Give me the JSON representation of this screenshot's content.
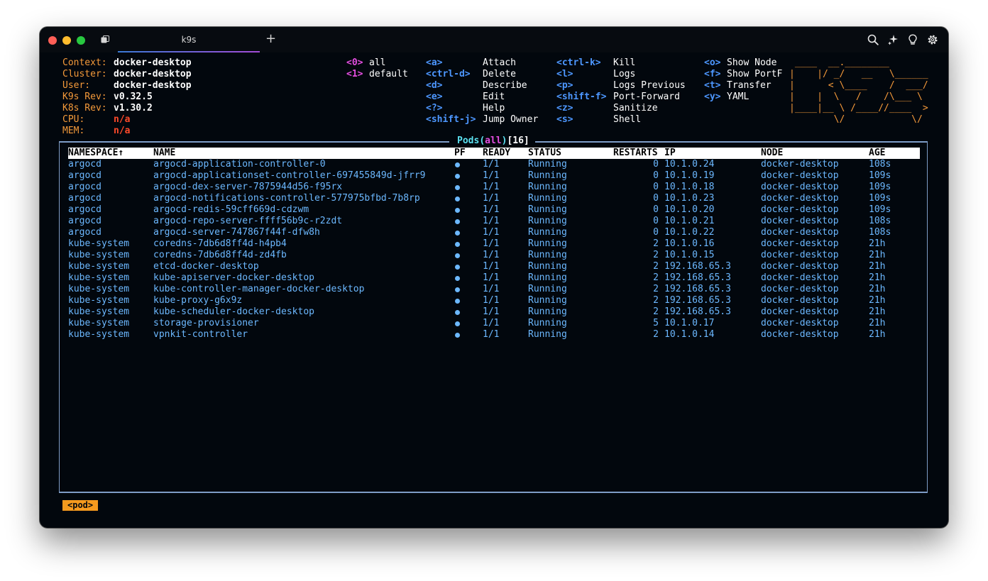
{
  "window": {
    "tab_title": "k9s",
    "new_tab_label": "+",
    "icons": [
      "tabs-overview-icon",
      "search-icon",
      "sparkle-icon",
      "lightbulb-icon",
      "gear-icon"
    ]
  },
  "info": {
    "labels": [
      "Context:",
      "Cluster:",
      "User:",
      "K9s Rev:",
      "K8s Rev:",
      "CPU:",
      "MEM:"
    ],
    "values": [
      "docker-desktop",
      "docker-desktop",
      "docker-desktop",
      "v0.32.5",
      "v1.30.2",
      "n/a",
      "n/a"
    ]
  },
  "namespaces": [
    {
      "key": "<0>",
      "label": "all"
    },
    {
      "key": "<1>",
      "label": "default"
    }
  ],
  "shortcuts": {
    "col1": [
      {
        "key": "<a>",
        "label": "Attach"
      },
      {
        "key": "<ctrl-d>",
        "label": "Delete"
      },
      {
        "key": "<d>",
        "label": "Describe"
      },
      {
        "key": "<e>",
        "label": "Edit"
      },
      {
        "key": "<?>",
        "label": "Help"
      },
      {
        "key": "<shift-j>",
        "label": "Jump Owner"
      }
    ],
    "col2": [
      {
        "key": "<ctrl-k>",
        "label": "Kill"
      },
      {
        "key": "<l>",
        "label": "Logs"
      },
      {
        "key": "<p>",
        "label": "Logs Previous"
      },
      {
        "key": "<shift-f>",
        "label": "Port-Forward"
      },
      {
        "key": "<z>",
        "label": "Sanitize"
      },
      {
        "key": "<s>",
        "label": "Shell"
      }
    ],
    "col3": [
      {
        "key": "<o>",
        "label": "Show Node"
      },
      {
        "key": "<f>",
        "label": "Show PortF"
      },
      {
        "key": "<t>",
        "label": "Transfer"
      },
      {
        "key": "<y>",
        "label": "YAML"
      }
    ]
  },
  "logo_lines": [
    " ____  __.________       ",
    "|    |/ _/   __   \\______",
    "|      < \\____    /  ___/",
    "|    |  \\   /    /\\___ \\ ",
    "|____|__ \\ /____//____  >",
    "        \\/            \\/ "
  ],
  "table": {
    "title_resource": "Pods",
    "title_paren_open": "(",
    "title_namespace": "all",
    "title_paren_close": ")",
    "title_count": "[16]",
    "columns": [
      "NAMESPACE↑",
      "NAME",
      "PF",
      "READY",
      "STATUS",
      "RESTARTS",
      "IP",
      "NODE",
      "AGE"
    ],
    "rows": [
      {
        "namespace": "argocd",
        "name": "argocd-application-controller-0",
        "ready": "1/1",
        "status": "Running",
        "restarts": "0",
        "ip": "10.1.0.24",
        "node": "docker-desktop",
        "age": "108s"
      },
      {
        "namespace": "argocd",
        "name": "argocd-applicationset-controller-697455849d-jfrr9",
        "ready": "1/1",
        "status": "Running",
        "restarts": "0",
        "ip": "10.1.0.19",
        "node": "docker-desktop",
        "age": "109s"
      },
      {
        "namespace": "argocd",
        "name": "argocd-dex-server-7875944d56-f95rx",
        "ready": "1/1",
        "status": "Running",
        "restarts": "0",
        "ip": "10.1.0.18",
        "node": "docker-desktop",
        "age": "109s"
      },
      {
        "namespace": "argocd",
        "name": "argocd-notifications-controller-577975bfbd-7b8rp",
        "ready": "1/1",
        "status": "Running",
        "restarts": "0",
        "ip": "10.1.0.23",
        "node": "docker-desktop",
        "age": "109s"
      },
      {
        "namespace": "argocd",
        "name": "argocd-redis-59cff669d-cdzwm",
        "ready": "1/1",
        "status": "Running",
        "restarts": "0",
        "ip": "10.1.0.20",
        "node": "docker-desktop",
        "age": "109s"
      },
      {
        "namespace": "argocd",
        "name": "argocd-repo-server-ffff56b9c-r2zdt",
        "ready": "1/1",
        "status": "Running",
        "restarts": "0",
        "ip": "10.1.0.21",
        "node": "docker-desktop",
        "age": "108s"
      },
      {
        "namespace": "argocd",
        "name": "argocd-server-747867f44f-dfw8h",
        "ready": "1/1",
        "status": "Running",
        "restarts": "0",
        "ip": "10.1.0.22",
        "node": "docker-desktop",
        "age": "108s"
      },
      {
        "namespace": "kube-system",
        "name": "coredns-7db6d8ff4d-h4pb4",
        "ready": "1/1",
        "status": "Running",
        "restarts": "2",
        "ip": "10.1.0.16",
        "node": "docker-desktop",
        "age": "21h"
      },
      {
        "namespace": "kube-system",
        "name": "coredns-7db6d8ff4d-zd4fb",
        "ready": "1/1",
        "status": "Running",
        "restarts": "2",
        "ip": "10.1.0.15",
        "node": "docker-desktop",
        "age": "21h"
      },
      {
        "namespace": "kube-system",
        "name": "etcd-docker-desktop",
        "ready": "1/1",
        "status": "Running",
        "restarts": "2",
        "ip": "192.168.65.3",
        "node": "docker-desktop",
        "age": "21h"
      },
      {
        "namespace": "kube-system",
        "name": "kube-apiserver-docker-desktop",
        "ready": "1/1",
        "status": "Running",
        "restarts": "2",
        "ip": "192.168.65.3",
        "node": "docker-desktop",
        "age": "21h"
      },
      {
        "namespace": "kube-system",
        "name": "kube-controller-manager-docker-desktop",
        "ready": "1/1",
        "status": "Running",
        "restarts": "2",
        "ip": "192.168.65.3",
        "node": "docker-desktop",
        "age": "21h"
      },
      {
        "namespace": "kube-system",
        "name": "kube-proxy-g6x9z",
        "ready": "1/1",
        "status": "Running",
        "restarts": "2",
        "ip": "192.168.65.3",
        "node": "docker-desktop",
        "age": "21h"
      },
      {
        "namespace": "kube-system",
        "name": "kube-scheduler-docker-desktop",
        "ready": "1/1",
        "status": "Running",
        "restarts": "2",
        "ip": "192.168.65.3",
        "node": "docker-desktop",
        "age": "21h"
      },
      {
        "namespace": "kube-system",
        "name": "storage-provisioner",
        "ready": "1/1",
        "status": "Running",
        "restarts": "5",
        "ip": "10.1.0.17",
        "node": "docker-desktop",
        "age": "21h"
      },
      {
        "namespace": "kube-system",
        "name": "vpnkit-controller",
        "ready": "1/1",
        "status": "Running",
        "restarts": "2",
        "ip": "10.1.0.14",
        "node": "docker-desktop",
        "age": "21h"
      }
    ]
  },
  "breadcrumb": "<pod>",
  "colors": {
    "background": "#02070d",
    "orange": "#f59a3a",
    "row_text": "#6cb8ff",
    "key_blue": "#4d97ff",
    "key_magenta": "#e44ee0",
    "alert_red": "#ff4a2a",
    "frame_border": "#7e9cc6",
    "title_cyan": "#5ce1f0"
  }
}
